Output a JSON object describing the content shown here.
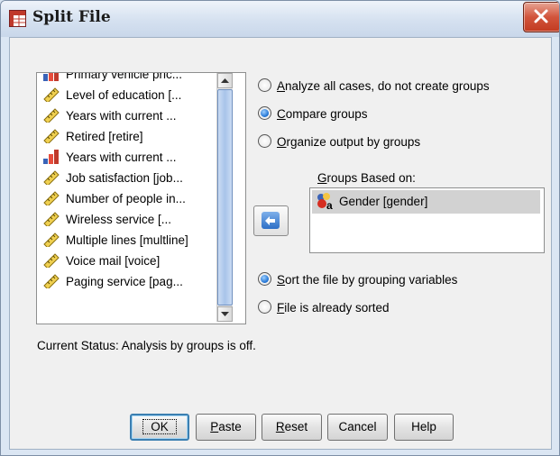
{
  "window": {
    "title": "Split File",
    "app_icon": "spss-table-icon",
    "close_icon": "close-icon"
  },
  "variables": [
    {
      "label": "Primary vehicle pric...",
      "icon": "ordinal-bars-icon"
    },
    {
      "label": "Level of education [...",
      "icon": "scale-ruler-icon"
    },
    {
      "label": "Years with current ...",
      "icon": "scale-ruler-icon"
    },
    {
      "label": "Retired [retire]",
      "icon": "scale-ruler-icon"
    },
    {
      "label": "Years with current ...",
      "icon": "ordinal-bars-icon"
    },
    {
      "label": "Job satisfaction [job...",
      "icon": "scale-ruler-icon"
    },
    {
      "label": "Number of people in...",
      "icon": "scale-ruler-icon"
    },
    {
      "label": "Wireless service [...",
      "icon": "scale-ruler-icon"
    },
    {
      "label": "Multiple lines [multline]",
      "icon": "scale-ruler-icon"
    },
    {
      "label": "Voice mail [voice]",
      "icon": "scale-ruler-icon"
    },
    {
      "label": "Paging service [pag...",
      "icon": "scale-ruler-icon"
    }
  ],
  "options": {
    "analyze_all": {
      "pre": "",
      "accel": "A",
      "post": "nalyze all cases, do not create groups",
      "selected": false
    },
    "compare": {
      "pre": "",
      "accel": "C",
      "post": "ompare groups",
      "selected": true
    },
    "organize": {
      "pre": "",
      "accel": "O",
      "post": "rganize output by groups",
      "selected": false
    }
  },
  "groups_based_on": {
    "label_accel": "G",
    "label_rest": "roups Based on:",
    "items": [
      {
        "label": "Gender [gender]",
        "icon": "nominal-variable-icon"
      }
    ]
  },
  "sort": {
    "sort_by_group": {
      "accel": "S",
      "post": "ort the file by grouping variables",
      "selected": true
    },
    "already_sorted": {
      "accel": "F",
      "post": "ile is already sorted",
      "selected": false
    }
  },
  "status": "Current Status: Analysis by groups is off.",
  "buttons": {
    "ok": "OK",
    "paste_accel": "P",
    "paste_rest": "aste",
    "reset_accel": "R",
    "reset_rest": "eset",
    "cancel": "Cancel",
    "help": "Help"
  }
}
